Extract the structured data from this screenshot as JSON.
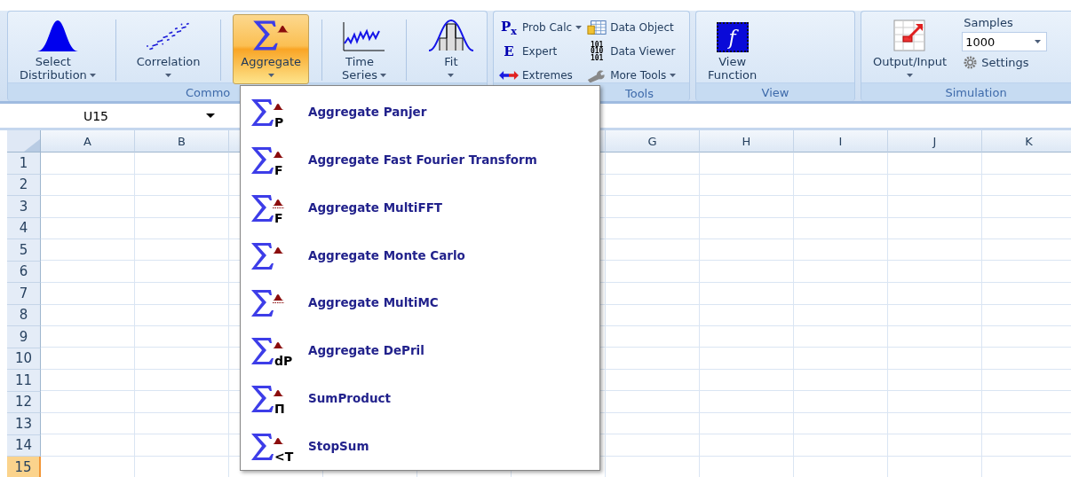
{
  "ribbon": {
    "groups": [
      {
        "kind": "large",
        "label": "Commo",
        "buttons": [
          {
            "kind": "bell",
            "label": "Select Distribution",
            "dropdown": true,
            "open": false
          },
          {
            "kind": "scatter",
            "label": "Correlation",
            "dropdown": true,
            "open": false
          },
          {
            "kind": "sigma",
            "label": "Aggregate",
            "dropdown": true,
            "open": true
          },
          {
            "kind": "series",
            "label": "Time Series",
            "dropdown": true,
            "open": false
          },
          {
            "kind": "fit",
            "label": "Fit",
            "dropdown": true,
            "open": false
          }
        ]
      },
      {
        "kind": "small",
        "label": "Tools",
        "items": [
          {
            "kind": "glyph",
            "glyph": "P$_{x}$",
            "label": "Prob Calc",
            "dropdown": true
          },
          {
            "kind": "glyph",
            "glyph": "E",
            "label": "Expert",
            "dropdown": false
          },
          {
            "kind": "arrows",
            "label": "Extremes",
            "dropdown": false
          },
          {
            "kind": "table",
            "label": "Data Object",
            "dropdown": false
          },
          {
            "kind": "binary",
            "glyph_lines": [
              "101",
              "010",
              "101"
            ],
            "label": "Data Viewer",
            "dropdown": false
          },
          {
            "kind": "wrench",
            "label": "More Tools",
            "dropdown": true
          }
        ]
      },
      {
        "kind": "large",
        "label": "View",
        "buttons": [
          {
            "kind": "function",
            "glyph": "f",
            "label": "View Function",
            "dropdown": false,
            "open": false
          }
        ]
      },
      {
        "kind": "simulation",
        "label": "Simulation",
        "buttons": [
          {
            "kind": "sheet",
            "label": "Output/Input",
            "dropdown": true,
            "open": false
          }
        ],
        "samples_label": "Samples",
        "samples_value": "1000",
        "settings_label": "Settings"
      }
    ]
  },
  "name_box": "U15",
  "grid": {
    "columns_left": [
      "A",
      "B"
    ],
    "columns_right": [
      "G",
      "H",
      "I",
      "J",
      "K"
    ],
    "rows": [
      {
        "label": "1",
        "selected": false
      },
      {
        "label": "2",
        "selected": false
      },
      {
        "label": "3",
        "selected": false
      },
      {
        "label": "4",
        "selected": false
      },
      {
        "label": "5",
        "selected": false
      },
      {
        "label": "6",
        "selected": false
      },
      {
        "label": "7",
        "selected": false
      },
      {
        "label": "8",
        "selected": false
      },
      {
        "label": "9",
        "selected": false
      },
      {
        "label": "10",
        "selected": false
      },
      {
        "label": "11",
        "selected": false
      },
      {
        "label": "12",
        "selected": false
      },
      {
        "label": "13",
        "selected": false
      },
      {
        "label": "14",
        "selected": false
      },
      {
        "label": "15",
        "selected": true
      }
    ]
  },
  "menu": {
    "items": [
      {
        "label": "Aggregate Panjer",
        "subscript": "P",
        "multi": false
      },
      {
        "label": "Aggregate Fast Fourier Transform",
        "subscript": "F",
        "multi": false
      },
      {
        "label": "Aggregate MultiFFT",
        "subscript": "F",
        "multi": true
      },
      {
        "label": "Aggregate Monte Carlo",
        "multi": false
      },
      {
        "label": "Aggregate MultiMC",
        "multi": true
      },
      {
        "label": "Aggregate DePril",
        "subscript": "dP",
        "multi": false
      },
      {
        "label": "SumProduct",
        "subscript": "Π",
        "multi": false
      },
      {
        "label": "StopSum",
        "subscript": "<T",
        "multi": false
      }
    ]
  }
}
